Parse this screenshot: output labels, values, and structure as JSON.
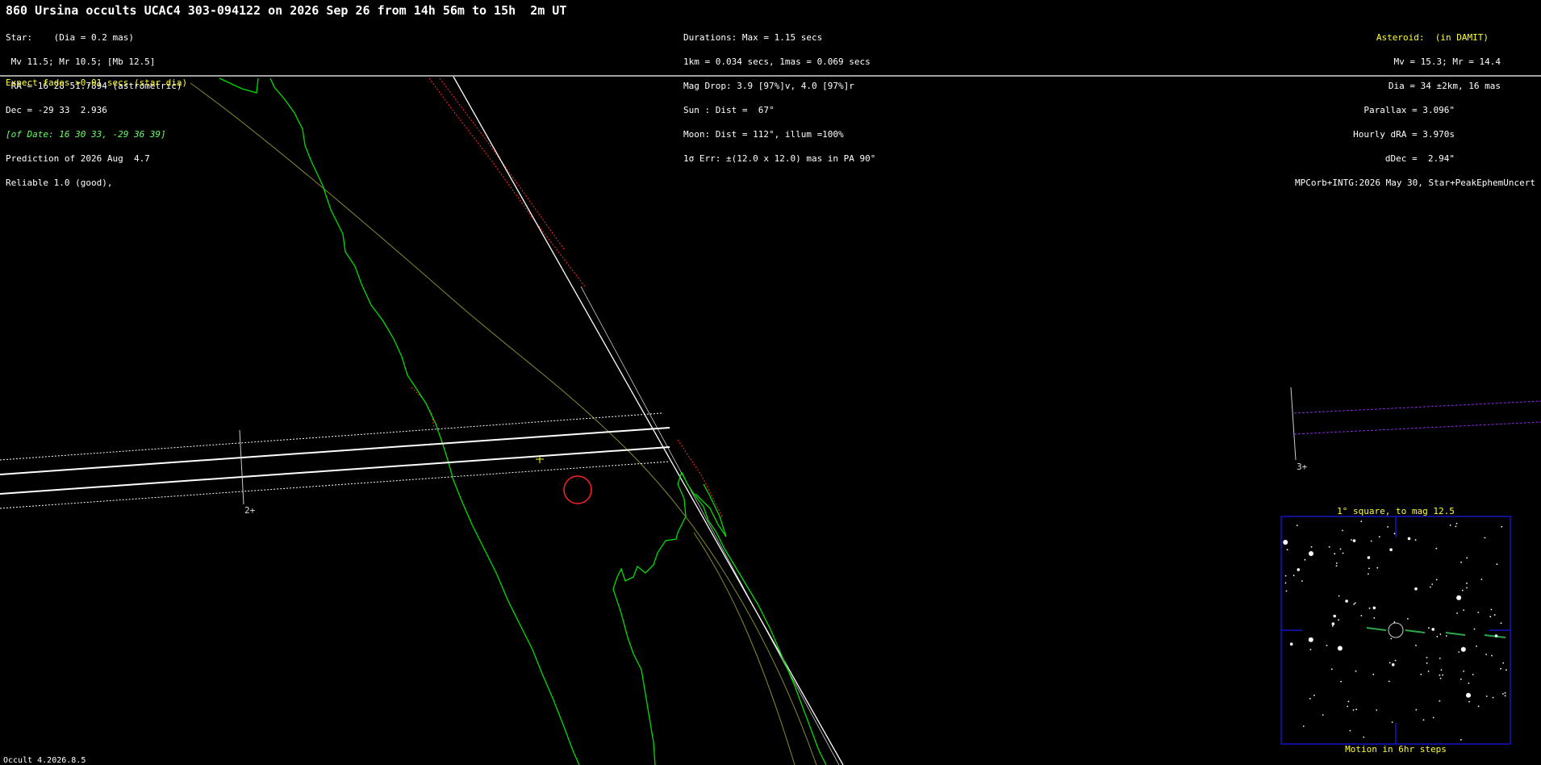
{
  "title": "860 Ursina occults UCAC4 303-094122 on 2026 Sep 26 from 14h 56m to 15h  2m UT",
  "left_block": {
    "star_label": "Star:    (Dia = 0.2 mas)",
    "mags": " Mv 11.5; Mr 10.5; [Mb 12.5]",
    "ra": " RA = 16 28 51.7894 (astrometric)",
    "dec": "Dec = -29 33  2.936",
    "of_date": "[of Date: 16 30 33, -29 36 39]",
    "prediction": "Prediction of 2026 Aug  4.7",
    "reliable": "Reliable 1.0 (good),"
  },
  "middle_block": {
    "durations": "Durations: Max = 1.15 secs",
    "scale": "1km = 0.034 secs, 1mas = 0.069 secs",
    "mag_drop": "Mag Drop: 3.9 [97%]v, 4.0 [97%]r",
    "sun": "Sun : Dist =  67°",
    "moon": "Moon: Dist = 112°, illum =100%",
    "err": "1σ Err: ±(12.0 x 12.0) mas in PA 90°"
  },
  "right_block": {
    "asteroid": "Asteroid:  (in DAMIT)",
    "mags": "Mv = 15.3; Mr = 14.4",
    "dia": "Dia = 34 ±2km, 16 mas",
    "parallax": "Parallax = 3.096\"",
    "hourly_dra": "Hourly dRA = 3.970s",
    "ddec": "dDec =  2.94\"",
    "source": "MPCorb+INTG:2026 May 30, Star+PeakEphemUncert"
  },
  "fades_note": "Expect fades >0.01 secs (star dia)",
  "time_marks": [
    {
      "label": "2+"
    },
    {
      "label": "3+"
    }
  ],
  "finder": {
    "title": "1° square, to mag 12.5",
    "caption": "Motion in 6hr steps"
  },
  "footer": "Occult 4.2026.8.5",
  "colors": {
    "coast": "#00dd00",
    "path": "#ffffff",
    "error_path": "#ffffff",
    "twilight": "#8a8a30",
    "sunrise": "#ff2a2a",
    "finder_frame": "#1414c8",
    "annotation": "#ffff33",
    "extra_path": "#8a2be2"
  }
}
